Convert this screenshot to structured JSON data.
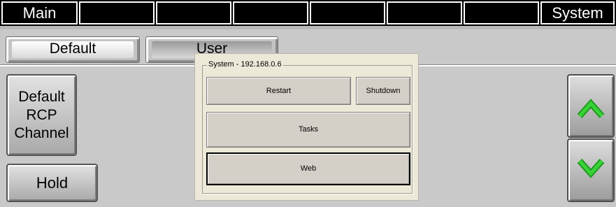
{
  "top_tabs": [
    {
      "label": "Main"
    },
    {
      "label": ""
    },
    {
      "label": ""
    },
    {
      "label": ""
    },
    {
      "label": ""
    },
    {
      "label": ""
    },
    {
      "label": ""
    },
    {
      "label": "System"
    }
  ],
  "mode_buttons": {
    "default_label": "Default",
    "user_label": "User"
  },
  "side_buttons": {
    "default_rcp_line1": "Default",
    "default_rcp_line2": "RCP",
    "default_rcp_line3": "Channel",
    "hold_label": "Hold"
  },
  "arrows": {
    "up_icon": "arrow-up-icon",
    "down_icon": "arrow-down-icon",
    "color": "#31c431"
  },
  "dialog": {
    "group_title": "System - 192.168.0.6",
    "restart_label": "Restart",
    "shutdown_label": "Shutdown",
    "tasks_label": "Tasks",
    "web_label": "Web"
  }
}
